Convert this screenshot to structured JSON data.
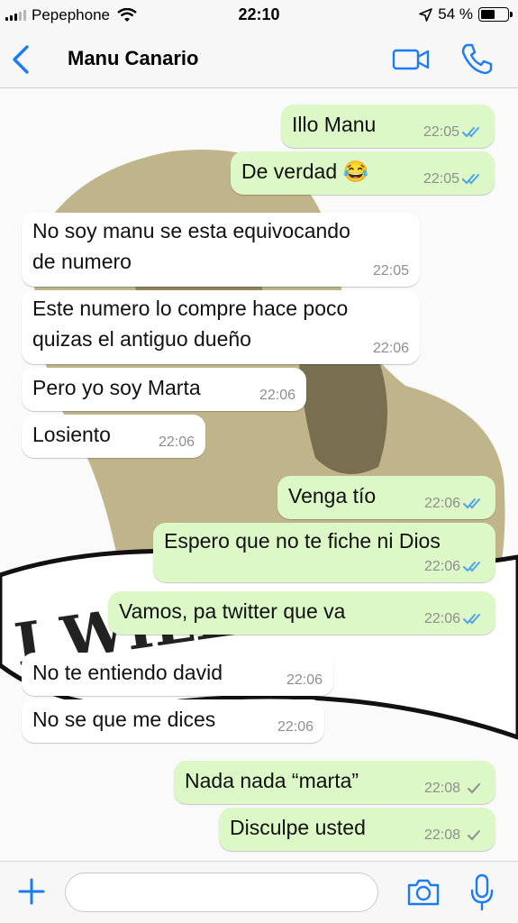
{
  "status_bar": {
    "carrier": "Pepephone",
    "time": "22:10",
    "battery": "54 %",
    "battery_level": 0.54
  },
  "header": {
    "contact_name": "Manu Canario",
    "video_icon": "video-call-icon",
    "call_icon": "phone-icon",
    "back_icon": "chevron-left-icon"
  },
  "messages": [
    {
      "dir": "out",
      "lines": [
        "Illo Manu"
      ],
      "time": "22:05",
      "status": "read"
    },
    {
      "dir": "out",
      "lines": [
        "De verdad 😂"
      ],
      "time": "22:05",
      "status": "read"
    },
    {
      "dir": "in",
      "lines": [
        "No soy manu se esta equivocando",
        "de numero"
      ],
      "time": "22:05"
    },
    {
      "dir": "in",
      "lines": [
        "Este numero lo compre hace poco",
        "quizas el antiguo dueño"
      ],
      "time": "22:06"
    },
    {
      "dir": "in",
      "lines": [
        "Pero yo soy Marta"
      ],
      "time": "22:06"
    },
    {
      "dir": "in",
      "lines": [
        "Losiento"
      ],
      "time": "22:06"
    },
    {
      "dir": "out",
      "lines": [
        "Venga tío"
      ],
      "time": "22:06",
      "status": "read"
    },
    {
      "dir": "out",
      "lines": [
        "Espero que no te fiche ni Dios"
      ],
      "time": "22:06",
      "status": "read"
    },
    {
      "dir": "out",
      "lines": [
        "Vamos, pa twitter que va"
      ],
      "time": "22:06",
      "status": "read"
    },
    {
      "dir": "in",
      "lines": [
        "No te entiendo david"
      ],
      "time": "22:06"
    },
    {
      "dir": "in",
      "lines": [
        "No se que me dices"
      ],
      "time": "22:06"
    },
    {
      "dir": "out",
      "lines": [
        "Nada nada “marta”"
      ],
      "time": "22:08",
      "status": "delivered"
    },
    {
      "dir": "out",
      "lines": [
        "Disculpe usted"
      ],
      "time": "22:08",
      "status": "delivered"
    }
  ],
  "wallpaper_text": "I WILL",
  "input_bar": {
    "placeholder": "",
    "plus_icon": "plus-icon",
    "camera_icon": "camera-icon",
    "mic_icon": "microphone-icon"
  },
  "colors": {
    "accent": "#1a7cf5",
    "outgoing_bubble": "#dcf8c6",
    "incoming_bubble": "#ffffff",
    "read_ticks": "#4fa3e8",
    "delivered_ticks": "#8e8e8e"
  }
}
